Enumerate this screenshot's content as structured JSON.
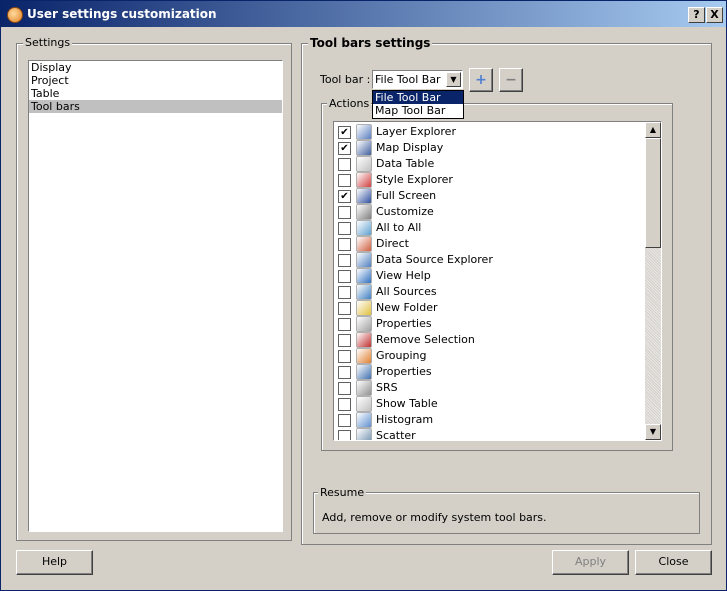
{
  "window": {
    "title": "User settings customization",
    "help_glyph": "?",
    "close_glyph": "X"
  },
  "settings": {
    "legend": "Settings",
    "items": [
      "Display",
      "Project",
      "Table",
      "Tool bars"
    ],
    "selected": "Tool bars"
  },
  "toolbars": {
    "header": "Tool bars settings",
    "toolbar_label": "Tool bar :",
    "toolbar_value": "File Tool Bar",
    "dropdown_options": [
      "File Tool Bar",
      "Map Tool Bar"
    ],
    "add_glyph": "+",
    "remove_glyph": "−"
  },
  "actions": {
    "legend": "Actions",
    "items": [
      {
        "label": "Layer Explorer",
        "checked": true,
        "icon": "layer-explorer-icon",
        "color": "#5a7fc0"
      },
      {
        "label": "Map Display",
        "checked": true,
        "icon": "map-display-icon",
        "color": "#4060a0"
      },
      {
        "label": "Data Table",
        "checked": false,
        "icon": "data-table-icon",
        "color": "#c0c0c0"
      },
      {
        "label": "Style Explorer",
        "checked": false,
        "icon": "style-explorer-icon",
        "color": "#d04040"
      },
      {
        "label": "Full Screen",
        "checked": true,
        "icon": "full-screen-icon",
        "color": "#3050a0"
      },
      {
        "label": "Customize",
        "checked": false,
        "icon": "customize-icon",
        "color": "#808080"
      },
      {
        "label": "All to All",
        "checked": false,
        "icon": "all-to-all-icon",
        "color": "#60a0d0"
      },
      {
        "label": "Direct",
        "checked": false,
        "icon": "direct-icon",
        "color": "#d06040"
      },
      {
        "label": "Data Source Explorer",
        "checked": false,
        "icon": "data-source-explorer-icon",
        "color": "#5080c0"
      },
      {
        "label": "View Help",
        "checked": false,
        "icon": "view-help-icon",
        "color": "#3070c0"
      },
      {
        "label": "All Sources",
        "checked": false,
        "icon": "all-sources-icon",
        "color": "#4080c0"
      },
      {
        "label": "New Folder",
        "checked": false,
        "icon": "new-folder-icon",
        "color": "#e0c040"
      },
      {
        "label": "Properties",
        "checked": false,
        "icon": "properties-icon",
        "color": "#a0a0a0"
      },
      {
        "label": "Remove Selection",
        "checked": false,
        "icon": "remove-selection-icon",
        "color": "#c03030"
      },
      {
        "label": "Grouping",
        "checked": false,
        "icon": "grouping-icon",
        "color": "#e08030"
      },
      {
        "label": "Properties",
        "checked": false,
        "icon": "properties-layer-icon",
        "color": "#4070b0"
      },
      {
        "label": "SRS",
        "checked": false,
        "icon": "srs-icon",
        "color": "#909090"
      },
      {
        "label": "Show Table",
        "checked": false,
        "icon": "show-table-icon",
        "color": "#c0c0c0"
      },
      {
        "label": "Histogram",
        "checked": false,
        "icon": "histogram-icon",
        "color": "#6090d0"
      },
      {
        "label": "Scatter",
        "checked": false,
        "icon": "scatter-icon",
        "color": "#7090b0"
      }
    ]
  },
  "resume": {
    "legend": "Resume",
    "text": "Add, remove or modify system tool bars."
  },
  "buttons": {
    "help": "Help",
    "apply": "Apply",
    "close": "Close"
  }
}
